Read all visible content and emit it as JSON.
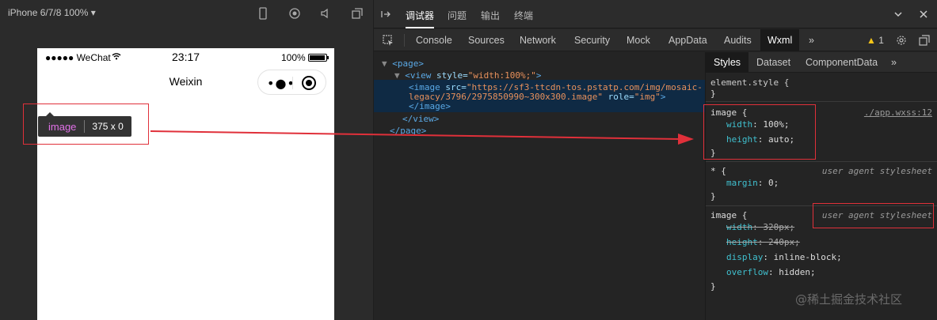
{
  "simulator": {
    "device": "iPhone 6/7/8 100% ▾",
    "status": {
      "carrier": "●●●●● WeChat",
      "time": "23:17",
      "battery": "100%"
    },
    "nav_title": "Weixin",
    "capsule_more": "•●•",
    "inspect_tag": "image",
    "inspect_size": "375 x 0"
  },
  "devtools": {
    "top_tabs": [
      "调试器",
      "问题",
      "输出",
      "终端"
    ],
    "panel_tabs": [
      "Console",
      "Sources",
      "Network",
      "Security",
      "Mock",
      "AppData",
      "Audits",
      "Wxml",
      "»"
    ],
    "warning_count": "1",
    "dom": {
      "page_open": "<page>",
      "view_open_tag": "<view",
      "view_attr": "style=",
      "view_val": "\"width:100%;\"",
      "view_close_bracket": ">",
      "image_tag": "<image",
      "src_attr": "src=",
      "src_val_1": "\"https://sf3-ttcdn-tos.pstatp.com/img/mosaic-",
      "src_val_2": "legacy/3796/2975850990~300x300.image\"",
      "role_attr": "role=",
      "role_val": "\"img\"",
      "image_close": "</image>",
      "view_close": "</view>",
      "page_close": "</page>"
    },
    "styles": {
      "tabs": [
        "Styles",
        "Dataset",
        "ComponentData",
        "»"
      ],
      "element_style": "element.style {",
      "close_brace": "}",
      "rule1": {
        "selector": "image {",
        "source": "./app.wxss:12",
        "p1": "width",
        "v1": "100%;",
        "p2": "height",
        "v2": "auto;"
      },
      "rule2": {
        "selector": "* {",
        "source": "user agent stylesheet",
        "p1": "margin",
        "v1": "0;"
      },
      "rule3": {
        "selector": "image {",
        "source": "user agent stylesheet",
        "p1": "width",
        "v1": "320px;",
        "p2": "height",
        "v2": "240px;",
        "p3": "display",
        "v3": "inline-block;",
        "p4": "overflow",
        "v4": "hidden;"
      }
    },
    "watermark": "@稀土掘金技术社区"
  },
  "colors": {
    "annotation": "#e0303a",
    "selected_bg": "#0f2a44",
    "accent_warning": "#f5c518"
  }
}
